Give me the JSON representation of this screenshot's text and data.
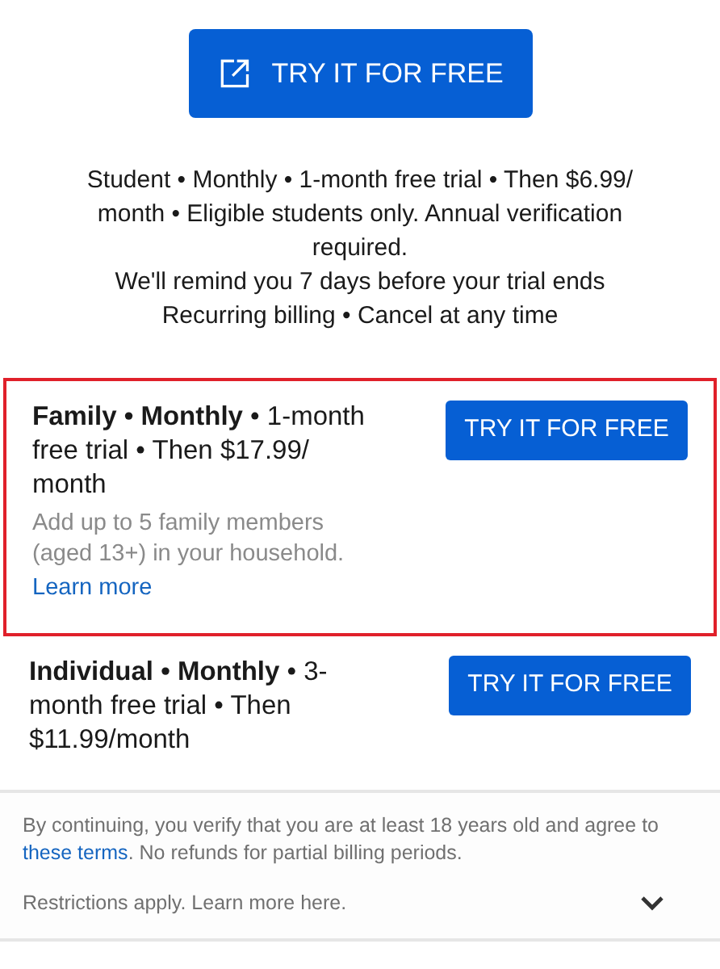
{
  "student": {
    "button": "TRY IT FOR FREE",
    "details": [
      "Student • Monthly • 1-month free trial • Then $6.99/ month • Eligible students only. Annual verification required.",
      "We'll remind you 7 days before your trial ends",
      "Recurring billing • Cancel at any time"
    ]
  },
  "plans": [
    {
      "title": "**Family • Monthly** • 1-month free trial • Then $17.99/ month",
      "description": "Add up to 5 family members (aged 13+) in your household.",
      "link": "Learn more",
      "button": "TRY IT FOR FREE",
      "highlighted": true
    },
    {
      "title": "**Individual • Monthly** • 3-month free trial • Then $11.99/month",
      "button": "TRY IT FOR FREE",
      "highlighted": false
    }
  ],
  "footer": {
    "terms_before": "By continuing, you verify that you are at least 18 years old and agree to ",
    "terms_link": "these terms",
    "terms_after": ". No refunds for partial billing periods.",
    "restrictions": "Restrictions apply. Learn more here.",
    "expanded": false
  }
}
